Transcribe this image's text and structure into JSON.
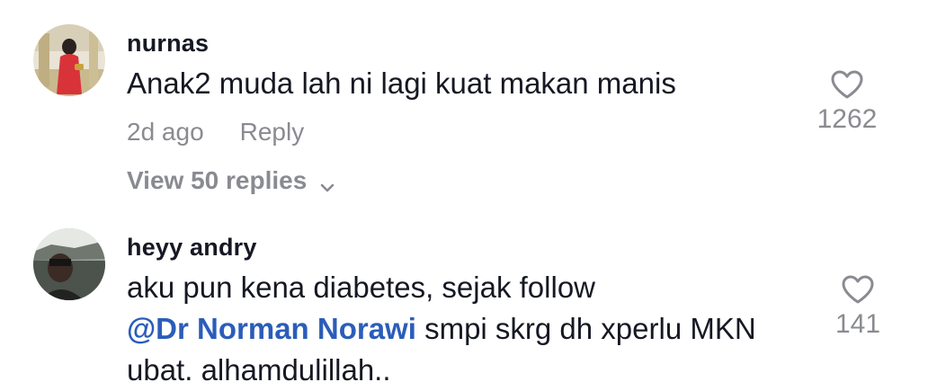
{
  "comments": [
    {
      "username": "nurnas",
      "text": "Anak2 muda lah ni lagi kuat makan manis",
      "time": "2d ago",
      "reply_label": "Reply",
      "likes": "1262",
      "view_replies": "View 50 replies"
    },
    {
      "username": "heyy andry",
      "text_before": "aku pun kena diabetes, sejak follow",
      "mention": "@Dr Norman Norawi",
      "text_after": " smpi skrg dh xperlu MKN ubat. alhamdulillah..",
      "likes": "141"
    }
  ],
  "colors": {
    "text": "#161823",
    "muted": "#8a8b91",
    "mention": "#2b5db9"
  },
  "icons": {
    "like": "heart-outline-icon",
    "expand": "chevron-down-icon"
  }
}
